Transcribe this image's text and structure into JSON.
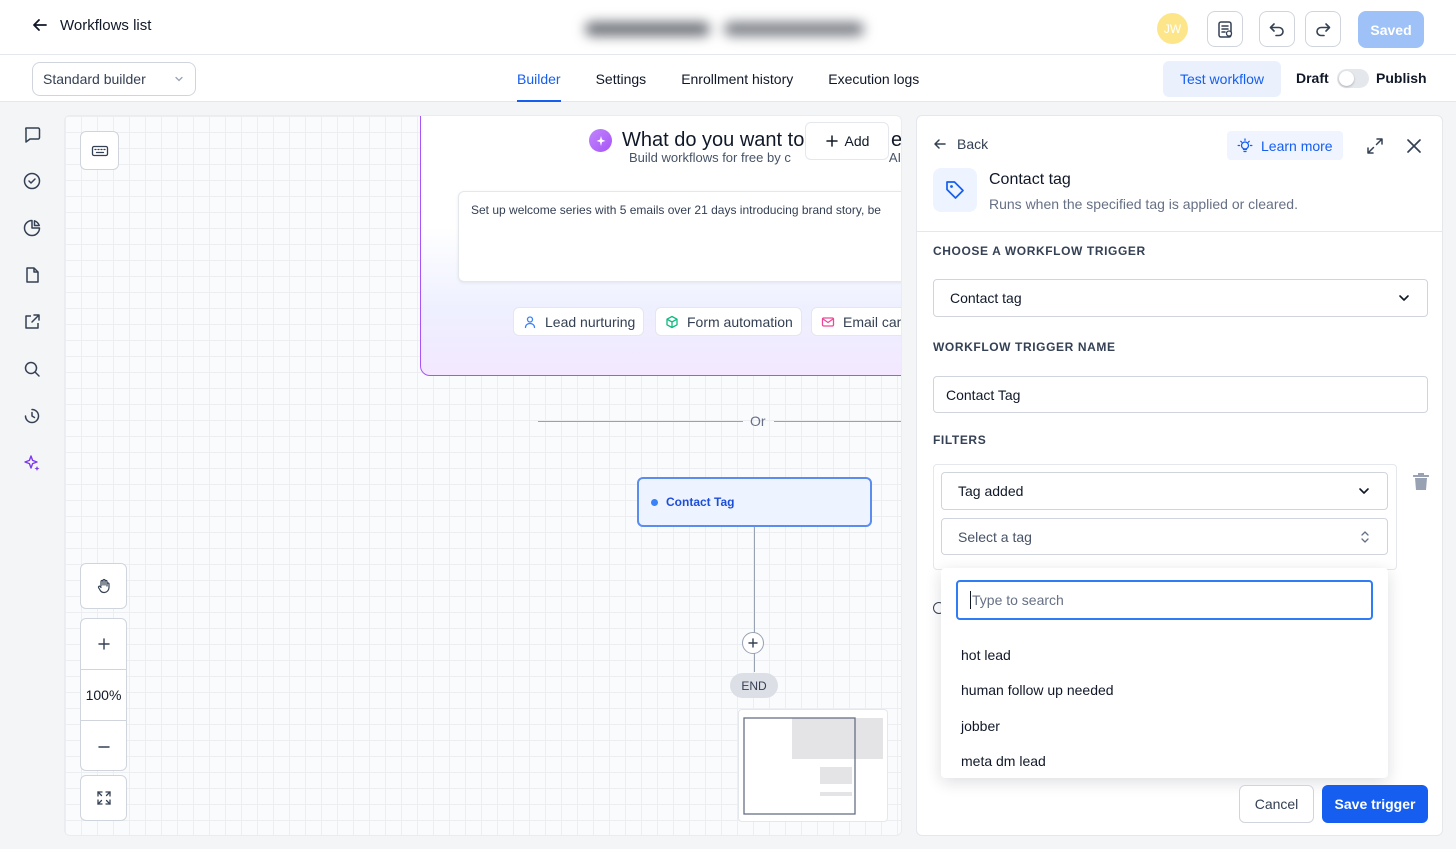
{
  "header": {
    "back_label": "Workflows list",
    "avatar_initials": "JW",
    "saved_label": "Saved"
  },
  "subbar": {
    "builder_mode": "Standard builder",
    "tabs": [
      {
        "label": "Builder",
        "active": true
      },
      {
        "label": "Settings",
        "active": false
      },
      {
        "label": "Enrollment history",
        "active": false
      },
      {
        "label": "Execution logs",
        "active": false
      }
    ],
    "test_label": "Test workflow",
    "draft_label": "Draft",
    "publish_label": "Publish",
    "publish_enabled": false
  },
  "rail": {
    "icons": [
      "chat-icon",
      "check-circle-icon",
      "pie-chart-icon",
      "file-icon",
      "external-link-icon",
      "search-icon",
      "history-icon",
      "sparkle-icon"
    ]
  },
  "canvas": {
    "zoom": "100%",
    "ai": {
      "title": "What do you want to automate?",
      "title_visible": "What do you want to",
      "title_end": "e?",
      "subtitle": "Build workflows for free by chatting with AI",
      "subtitle_visible_start": "Build workflows for free by c",
      "subtitle_visible_end": "AI",
      "add_label": "Add",
      "prompt": "Set up welcome series with 5 emails over 21 days introducing brand story, be",
      "chips": [
        "Lead nurturing",
        "Form automation",
        "Email cam"
      ]
    },
    "or_label": "Or",
    "trigger_node": "Contact Tag",
    "end_label": "END"
  },
  "panel": {
    "back_label": "Back",
    "learn_more": "Learn more",
    "trigger_title": "Contact tag",
    "trigger_desc": "Runs when the specified tag is applied or cleared.",
    "choose_label": "CHOOSE A WORKFLOW TRIGGER",
    "choose_value": "Contact tag",
    "name_label": "WORKFLOW TRIGGER NAME",
    "name_value": "Contact Tag",
    "filters_label": "FILTERS",
    "filter_type": "Tag added",
    "tag_placeholder": "Select a tag",
    "search_placeholder": "Type to search",
    "tag_options": [
      "hot lead",
      "human follow up needed",
      "jobber",
      "meta dm lead"
    ],
    "cancel_label": "Cancel",
    "save_label": "Save trigger"
  },
  "colors": {
    "primary": "#155eef",
    "ai_border": "#a855f7",
    "node_border": "#5b8def",
    "saved_disabled": "#9ec1f7"
  }
}
